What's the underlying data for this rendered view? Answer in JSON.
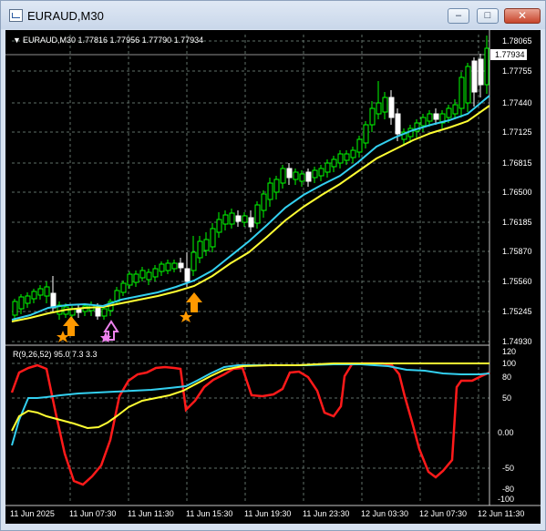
{
  "window": {
    "title": "EURAUD,M30",
    "minimize_glyph": "–",
    "maximize_glyph": "□",
    "close_glyph": "✕"
  },
  "chart": {
    "header": "EURAUD,M30  1.77816 1.77956 1.77790 1.77934",
    "current_price": "1.77934",
    "price_ticks": [
      "1.78065",
      "1.77755",
      "1.77440",
      "1.77125",
      "1.76815",
      "1.76500",
      "1.76185",
      "1.75870",
      "1.75560",
      "1.75245",
      "1.74930"
    ],
    "indicator_header": "R(9,26,52) 95.0 7.3 3.3",
    "indicator_ticks": [
      "120",
      "100",
      "80",
      "50",
      "0.00",
      "-50",
      "-80",
      "-100"
    ],
    "time_ticks": [
      "11 Jun 2025",
      "11 Jun 07:30",
      "11 Jun 11:30",
      "11 Jun 15:30",
      "11 Jun 19:30",
      "11 Jun 23:30",
      "12 Jun 03:30",
      "12 Jun 07:30",
      "12 Jun 11:30"
    ],
    "colors": {
      "background": "#000000",
      "grid": "#5f6f68",
      "bull_candle": "#00ff00",
      "doji": "#ffffff",
      "ma_fast": "#33d0f0",
      "ma_slow": "#ffff33",
      "oscillator": "#ff1a1a",
      "arrow_buy": "#ff9900",
      "arrow_alt": "#ee82ee"
    }
  },
  "chart_data": [
    {
      "type": "candlestick",
      "title": "EURAUD,M30",
      "ylim": [
        1.7493,
        1.78065
      ],
      "ma_fast_values": [
        1.752,
        1.7525,
        1.753,
        1.7532,
        1.7534,
        1.7533,
        1.753,
        1.7528,
        1.7535,
        1.7542,
        1.7548,
        1.7555,
        1.756,
        1.757,
        1.758,
        1.7595,
        1.761,
        1.7625,
        1.765,
        1.767,
        1.7688,
        1.77,
        1.772,
        1.773,
        1.774,
        1.7745,
        1.7752
      ],
      "ma_slow_values": [
        1.7515,
        1.7518,
        1.7522,
        1.7525,
        1.7527,
        1.7528,
        1.7528,
        1.7528,
        1.7532,
        1.7537,
        1.7542,
        1.7548,
        1.7552,
        1.756,
        1.757,
        1.758,
        1.7596,
        1.761,
        1.763,
        1.765,
        1.7668,
        1.768,
        1.7698,
        1.771,
        1.7722,
        1.7732,
        1.7743
      ]
    },
    {
      "type": "line",
      "title": "R(9,26,52) 95.0 7.3 3.3",
      "ylim": [
        -100,
        120
      ],
      "series": [
        {
          "name": "95.0",
          "values": [
            60,
            85,
            90,
            40,
            -40,
            -80,
            -70,
            20,
            70,
            80,
            85,
            30,
            60,
            75,
            50,
            55,
            85,
            70,
            10,
            90,
            95,
            92,
            85,
            -20,
            -70,
            70,
            95
          ]
        },
        {
          "name": "7.3",
          "values": [
            -20,
            50,
            52,
            55,
            58,
            60,
            62,
            65,
            70,
            78,
            88,
            95,
            97,
            97,
            97,
            96,
            96,
            95,
            95,
            95,
            93,
            90,
            88,
            86,
            85,
            86,
            87
          ]
        },
        {
          "name": "3.3",
          "values": [
            0,
            35,
            28,
            20,
            12,
            20,
            35,
            50,
            58,
            72,
            85,
            92,
            95,
            96,
            97,
            97,
            98,
            98,
            98,
            98,
            98,
            98,
            98,
            98,
            98,
            98,
            98
          ]
        }
      ]
    }
  ]
}
